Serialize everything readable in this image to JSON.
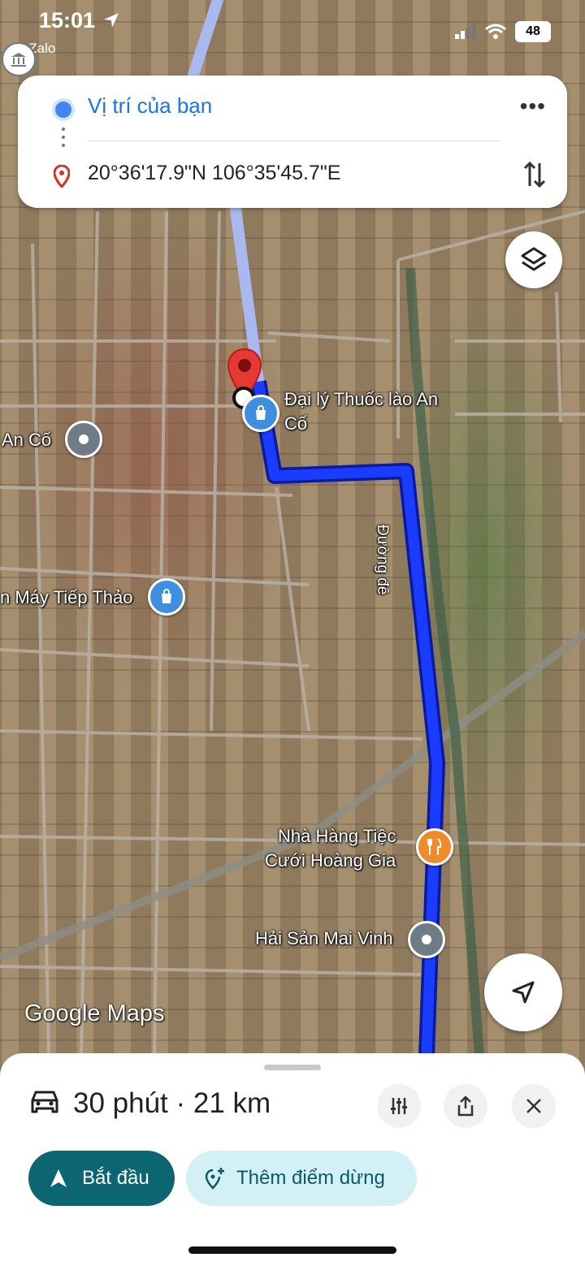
{
  "status_bar": {
    "time": "15:01",
    "back_app": "Zalo",
    "battery": "48"
  },
  "route_card": {
    "origin": "Vị trí của bạn",
    "destination": "20°36'17.9\"N 106°35'45.7\"E",
    "more_icon": "more-horizontal-icon",
    "swap_icon": "swap-vertical-icon"
  },
  "map": {
    "labels": {
      "poi_tobacco": "Đại lý Thuốc lào An",
      "poi_tobacco_line2": "Cố",
      "village": "An Cố",
      "poi_motorbike": "n Máy Tiếp Thảo",
      "road_name": "Đường đê",
      "poi_restaurant_line1": "Nhà Hàng Tiệc",
      "poi_restaurant_line2": "Cưới Hoàng Gia",
      "poi_seafood": "Hải Sản Mai Vinh",
      "road_top": "Đư"
    },
    "attribution": "Google Maps",
    "colors": {
      "route": "#1a3cff",
      "route_outline": "#0b1a9e",
      "alt_route": "#a9b9f0",
      "pin": "#e53935"
    }
  },
  "sheet": {
    "trip": "30 phút · 21 km",
    "start_label": "Bắt đầu",
    "add_stop_label": "Thêm điểm dừng"
  }
}
